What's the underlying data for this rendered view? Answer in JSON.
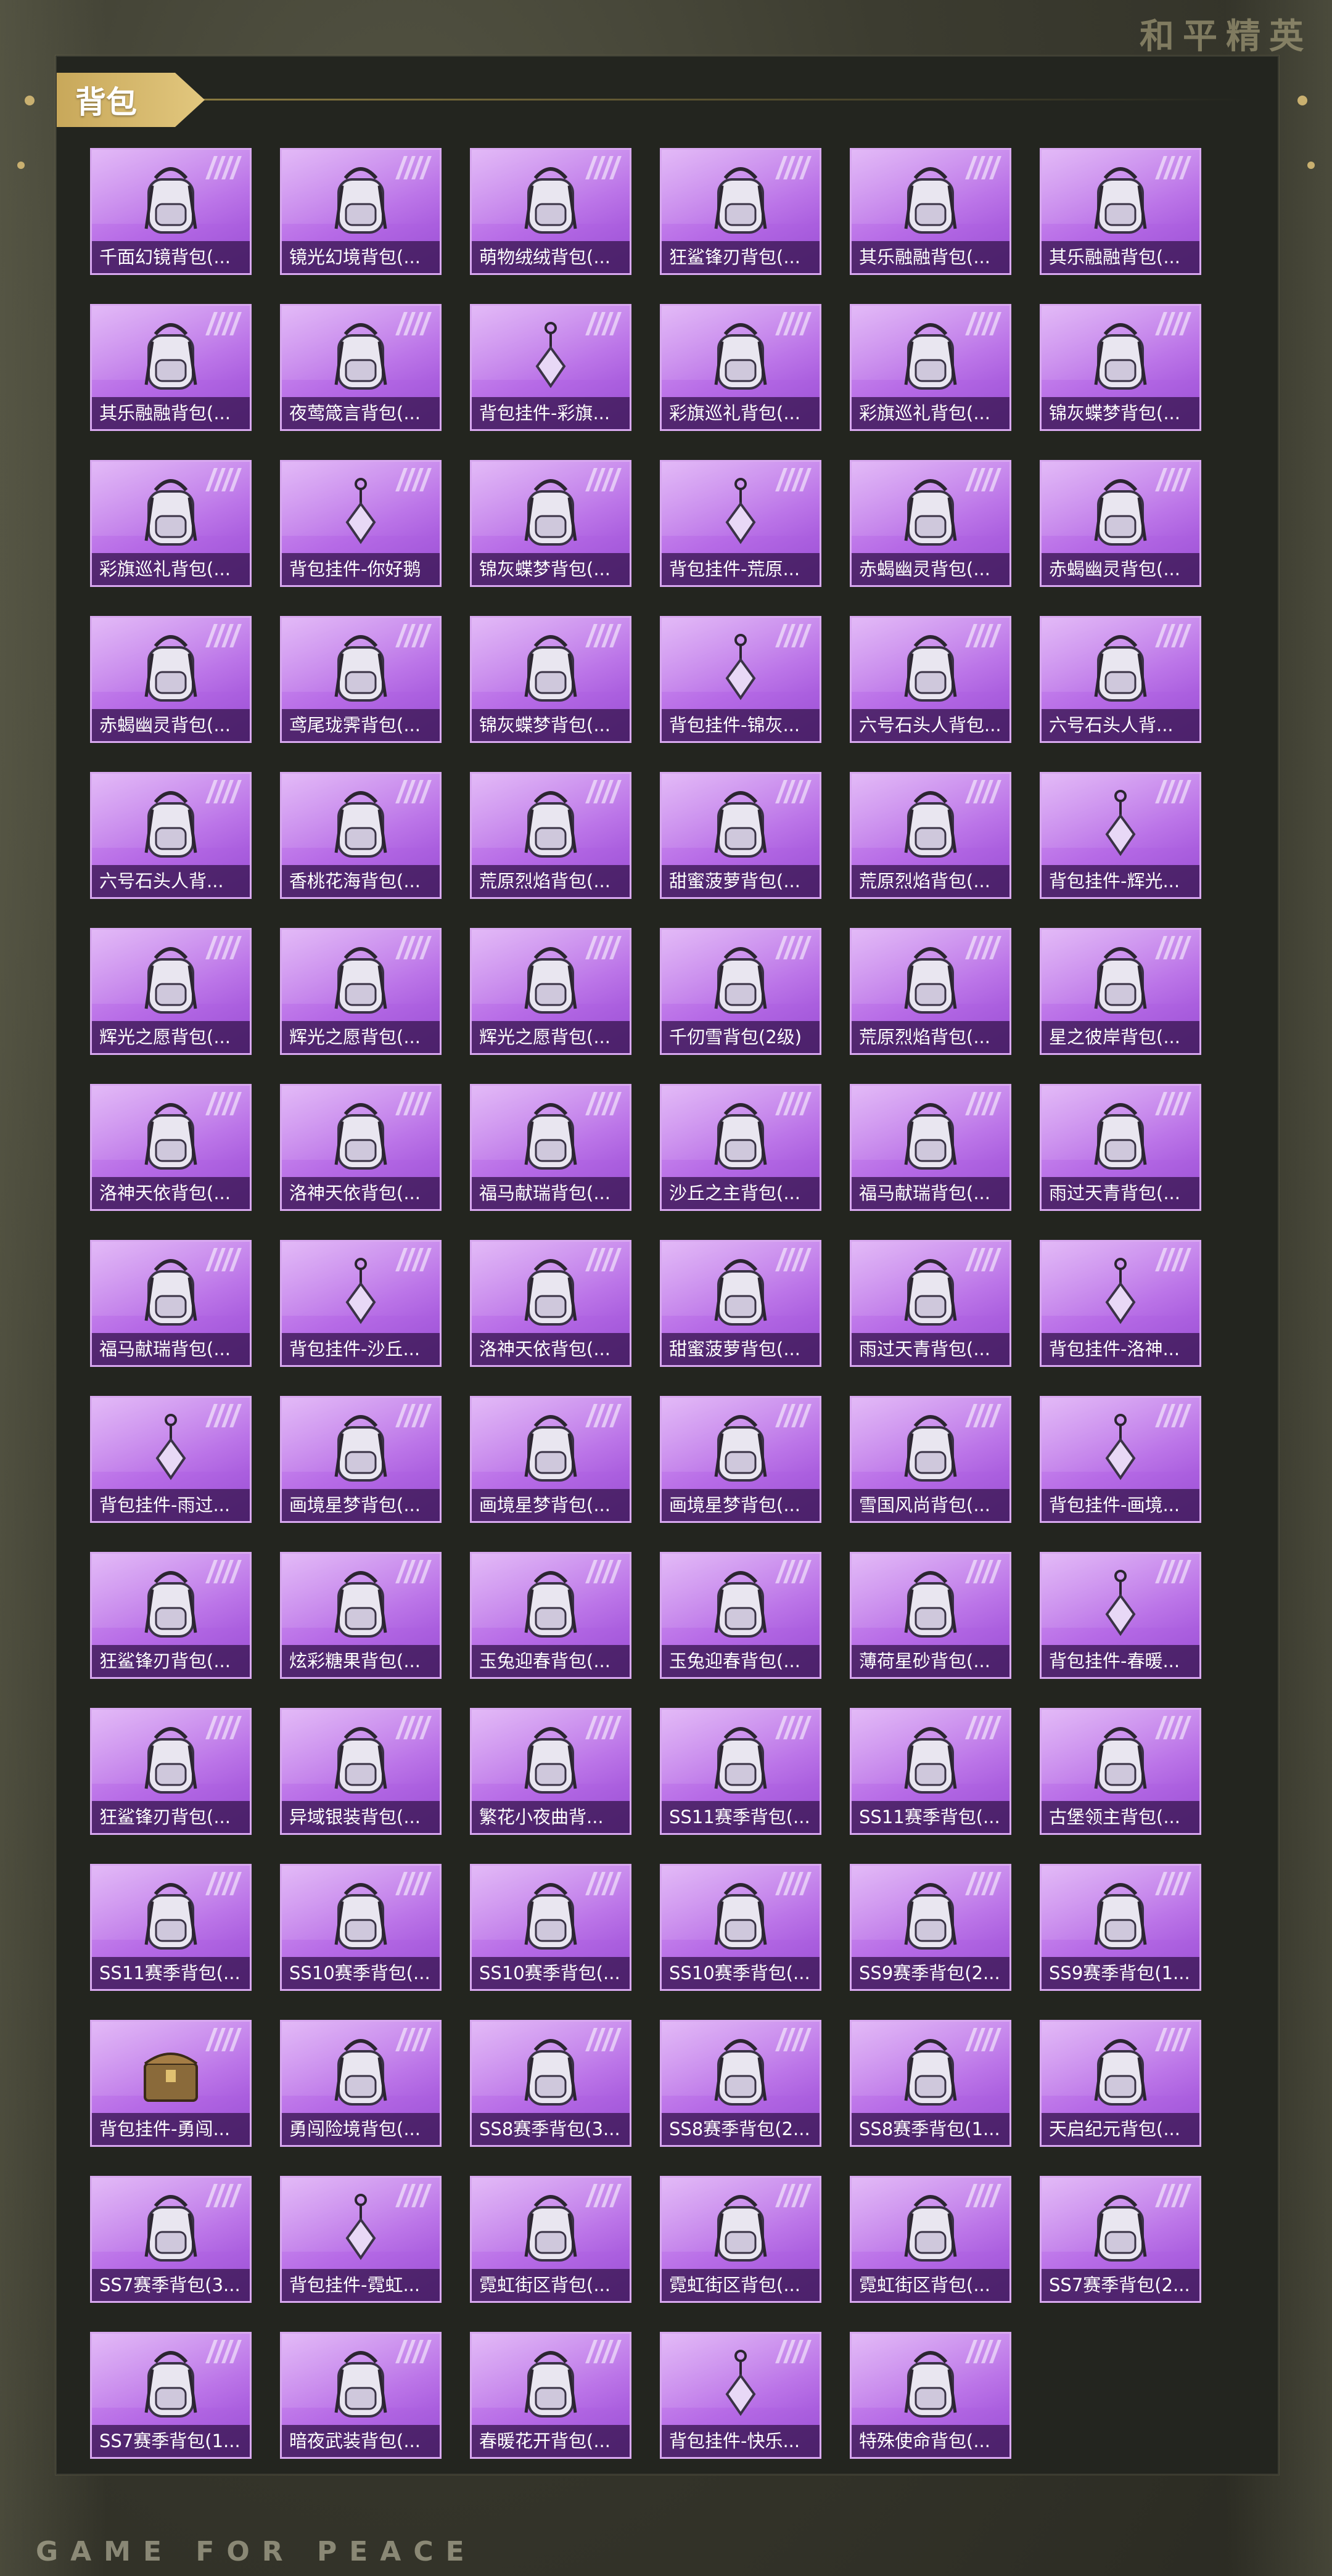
{
  "header": {
    "brand": "和平精英"
  },
  "footer": {
    "brand": "GAME FOR PEACE"
  },
  "category": {
    "label": "背包"
  },
  "colors": {
    "rarity_purple": "#b66ae6",
    "accent_gold": "#d4b46a"
  },
  "items": [
    {
      "name": "千面幻镜背包(...",
      "icon": "backpack-icon"
    },
    {
      "name": "镜光幻境背包(...",
      "icon": "backpack-icon"
    },
    {
      "name": "萌物绒绒背包(...",
      "icon": "backpack-icon"
    },
    {
      "name": "狂鲨锋刃背包(...",
      "icon": "backpack-icon"
    },
    {
      "name": "其乐融融背包(...",
      "icon": "backpack-icon"
    },
    {
      "name": "其乐融融背包(...",
      "icon": "backpack-icon"
    },
    {
      "name": "其乐融融背包(...",
      "icon": "backpack-icon"
    },
    {
      "name": "夜莺箴言背包(...",
      "icon": "backpack-icon"
    },
    {
      "name": "背包挂件-彩旗...",
      "icon": "pendant-icon"
    },
    {
      "name": "彩旗巡礼背包(...",
      "icon": "backpack-icon"
    },
    {
      "name": "彩旗巡礼背包(...",
      "icon": "backpack-icon"
    },
    {
      "name": "锦灰蝶梦背包(...",
      "icon": "backpack-icon"
    },
    {
      "name": "彩旗巡礼背包(...",
      "icon": "backpack-icon"
    },
    {
      "name": "背包挂件-你好鹅",
      "icon": "pendant-icon"
    },
    {
      "name": "锦灰蝶梦背包(...",
      "icon": "backpack-icon"
    },
    {
      "name": "背包挂件-荒原...",
      "icon": "pendant-icon"
    },
    {
      "name": "赤蝎幽灵背包(...",
      "icon": "backpack-icon"
    },
    {
      "name": "赤蝎幽灵背包(...",
      "icon": "backpack-icon"
    },
    {
      "name": "赤蝎幽灵背包(...",
      "icon": "backpack-icon"
    },
    {
      "name": "鸢尾珑霁背包(...",
      "icon": "backpack-icon"
    },
    {
      "name": "锦灰蝶梦背包(...",
      "icon": "backpack-icon"
    },
    {
      "name": "背包挂件-锦灰...",
      "icon": "pendant-icon"
    },
    {
      "name": "六号石头人背包...",
      "icon": "backpack-icon"
    },
    {
      "name": "六号石头人背...",
      "icon": "backpack-icon"
    },
    {
      "name": "六号石头人背...",
      "icon": "backpack-icon"
    },
    {
      "name": "香桃花海背包(...",
      "icon": "backpack-icon"
    },
    {
      "name": "荒原烈焰背包(...",
      "icon": "backpack-icon"
    },
    {
      "name": "甜蜜菠萝背包(...",
      "icon": "backpack-icon"
    },
    {
      "name": "荒原烈焰背包(...",
      "icon": "backpack-icon"
    },
    {
      "name": "背包挂件-辉光...",
      "icon": "pendant-icon"
    },
    {
      "name": "辉光之愿背包(...",
      "icon": "backpack-icon"
    },
    {
      "name": "辉光之愿背包(...",
      "icon": "backpack-icon"
    },
    {
      "name": "辉光之愿背包(...",
      "icon": "backpack-icon"
    },
    {
      "name": "千仞雪背包(2级)",
      "icon": "backpack-icon"
    },
    {
      "name": "荒原烈焰背包(...",
      "icon": "backpack-icon"
    },
    {
      "name": "星之彼岸背包(...",
      "icon": "backpack-icon"
    },
    {
      "name": "洛神天依背包(...",
      "icon": "backpack-icon"
    },
    {
      "name": "洛神天依背包(...",
      "icon": "backpack-icon"
    },
    {
      "name": "福马献瑞背包(...",
      "icon": "backpack-icon"
    },
    {
      "name": "沙丘之主背包(...",
      "icon": "backpack-icon"
    },
    {
      "name": "福马献瑞背包(...",
      "icon": "backpack-icon"
    },
    {
      "name": "雨过天青背包(...",
      "icon": "backpack-icon"
    },
    {
      "name": "福马献瑞背包(...",
      "icon": "backpack-icon"
    },
    {
      "name": "背包挂件-沙丘...",
      "icon": "pendant-icon"
    },
    {
      "name": "洛神天依背包(...",
      "icon": "backpack-icon"
    },
    {
      "name": "甜蜜菠萝背包(...",
      "icon": "backpack-icon"
    },
    {
      "name": "雨过天青背包(...",
      "icon": "backpack-icon"
    },
    {
      "name": "背包挂件-洛神...",
      "icon": "pendant-icon"
    },
    {
      "name": "背包挂件-雨过...",
      "icon": "pendant-icon"
    },
    {
      "name": "画境星梦背包(...",
      "icon": "backpack-icon"
    },
    {
      "name": "画境星梦背包(...",
      "icon": "backpack-icon"
    },
    {
      "name": "画境星梦背包(...",
      "icon": "backpack-icon"
    },
    {
      "name": "雪国风尚背包(...",
      "icon": "backpack-icon"
    },
    {
      "name": "背包挂件-画境...",
      "icon": "pendant-icon"
    },
    {
      "name": "狂鲨锋刃背包(...",
      "icon": "backpack-icon"
    },
    {
      "name": "炫彩糖果背包(...",
      "icon": "backpack-icon"
    },
    {
      "name": "玉兔迎春背包(...",
      "icon": "backpack-icon"
    },
    {
      "name": "玉兔迎春背包(...",
      "icon": "backpack-icon"
    },
    {
      "name": "薄荷星砂背包(...",
      "icon": "backpack-icon"
    },
    {
      "name": "背包挂件-春暖...",
      "icon": "pendant-icon"
    },
    {
      "name": "狂鲨锋刃背包(...",
      "icon": "backpack-icon"
    },
    {
      "name": "异域银装背包(...",
      "icon": "backpack-icon"
    },
    {
      "name": "繁花小夜曲背...",
      "icon": "backpack-icon"
    },
    {
      "name": "SS11赛季背包(...",
      "icon": "backpack-icon"
    },
    {
      "name": "SS11赛季背包(...",
      "icon": "backpack-icon"
    },
    {
      "name": "古堡领主背包(...",
      "icon": "backpack-icon"
    },
    {
      "name": "SS11赛季背包(...",
      "icon": "backpack-icon"
    },
    {
      "name": "SS10赛季背包(...",
      "icon": "backpack-icon"
    },
    {
      "name": "SS10赛季背包(...",
      "icon": "backpack-icon"
    },
    {
      "name": "SS10赛季背包(...",
      "icon": "backpack-icon"
    },
    {
      "name": "SS9赛季背包(2...",
      "icon": "backpack-icon"
    },
    {
      "name": "SS9赛季背包(1...",
      "icon": "backpack-icon"
    },
    {
      "name": "背包挂件-勇闯...",
      "icon": "chest-icon"
    },
    {
      "name": "勇闯险境背包(...",
      "icon": "backpack-icon"
    },
    {
      "name": "SS8赛季背包(3...",
      "icon": "backpack-icon"
    },
    {
      "name": "SS8赛季背包(2...",
      "icon": "backpack-icon"
    },
    {
      "name": "SS8赛季背包(1...",
      "icon": "backpack-icon"
    },
    {
      "name": "天启纪元背包(...",
      "icon": "backpack-icon"
    },
    {
      "name": "SS7赛季背包(3...",
      "icon": "backpack-icon"
    },
    {
      "name": "背包挂件-霓虹...",
      "icon": "pendant-icon"
    },
    {
      "name": "霓虹街区背包(...",
      "icon": "backpack-icon"
    },
    {
      "name": "霓虹街区背包(...",
      "icon": "backpack-icon"
    },
    {
      "name": "霓虹街区背包(...",
      "icon": "backpack-icon"
    },
    {
      "name": "SS7赛季背包(2...",
      "icon": "backpack-icon"
    },
    {
      "name": "SS7赛季背包(1...",
      "icon": "backpack-icon"
    },
    {
      "name": "暗夜武装背包(...",
      "icon": "backpack-icon"
    },
    {
      "name": "春暖花开背包(...",
      "icon": "backpack-icon"
    },
    {
      "name": "背包挂件-快乐...",
      "icon": "pendant-icon"
    },
    {
      "name": "特殊使命背包(...",
      "icon": "backpack-icon"
    }
  ]
}
